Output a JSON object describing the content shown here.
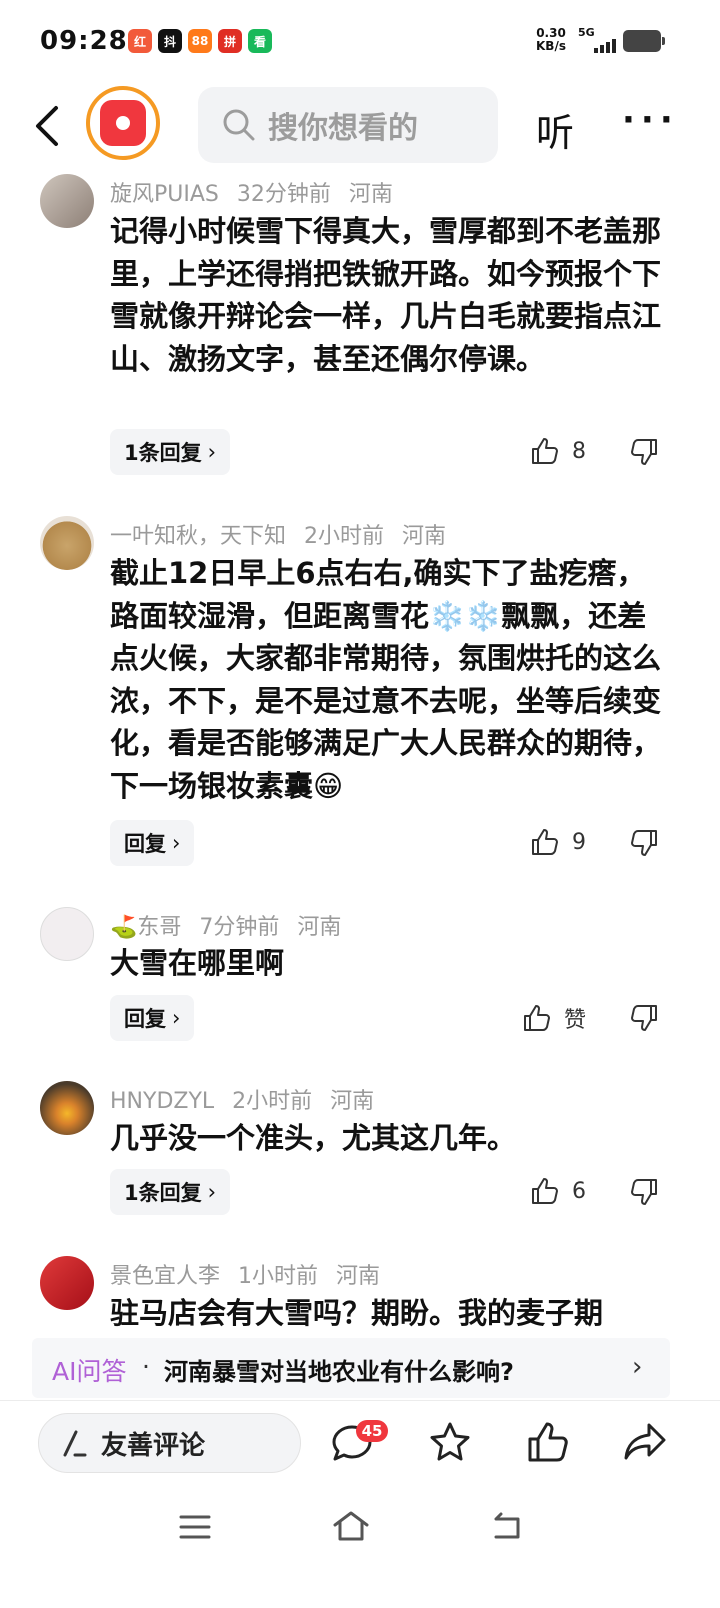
{
  "status_bar": {
    "time": "09:28",
    "apps": [
      {
        "label": "红",
        "color": "#f25a3a"
      },
      {
        "label": "抖",
        "color": "#111111"
      },
      {
        "label": "88",
        "color": "#ff7a1a"
      },
      {
        "label": "拼",
        "color": "#e02e24"
      },
      {
        "label": "看",
        "color": "#19b95a"
      }
    ],
    "net_speed": "0.30",
    "net_unit": "KB/s",
    "signal": "5G"
  },
  "header": {
    "search_placeholder": "搜你想看的",
    "listen_label": "听",
    "more_label": "···"
  },
  "comments": [
    {
      "author": "旋风PUIAS",
      "time": "32分钟前",
      "location": "河南",
      "text": "记得小时候雪下得真大，雪厚都到不老盖那里，上学还得捎把铁锨开路。如今预报个下雪就像开辩论会一样，几片白毛就要指点江山、激扬文字，甚至还偶尔停课。",
      "reply_label": "1条回复",
      "likes": "8"
    },
    {
      "author": "一叶知秋，天下知",
      "time": "2小时前",
      "location": "河南",
      "text": "截止12日早上6点右右,确实下了盐疙瘩，路面较湿滑，但距离雪花❄️❄️飘飘，还差点火候，大家都非常期待，氛围烘托的这么浓，不下，是不是过意不去呢，坐等后续变化，看是否能够满足广大人民群众的期待，下一场银妆素囊😁",
      "reply_label": "回复",
      "likes": "9"
    },
    {
      "author": "⛳东哥",
      "time": "7分钟前",
      "location": "河南",
      "text": "大雪在哪里啊",
      "reply_label": "回复",
      "likes": "赞"
    },
    {
      "author": "HNYDZYL",
      "time": "2小时前",
      "location": "河南",
      "text": "几乎没一个准头，尤其这几年。",
      "reply_label": "1条回复",
      "likes": "6"
    },
    {
      "author": "景色宜人李",
      "time": "1小时前",
      "location": "河南",
      "text": "驻马店会有大雪吗？期盼。我的麦子期"
    }
  ],
  "ai_bar": {
    "label": "AI问答",
    "separator": "·",
    "question": "河南暴雪对当地农业有什么影响?",
    "chevron": "›"
  },
  "bottom_bar": {
    "comment_placeholder": "友善评论",
    "comment_count": "45"
  },
  "colors": {
    "accent_red": "#f0373e",
    "ai_purple": "#b061d6",
    "logo_ring": "#f59a23"
  }
}
